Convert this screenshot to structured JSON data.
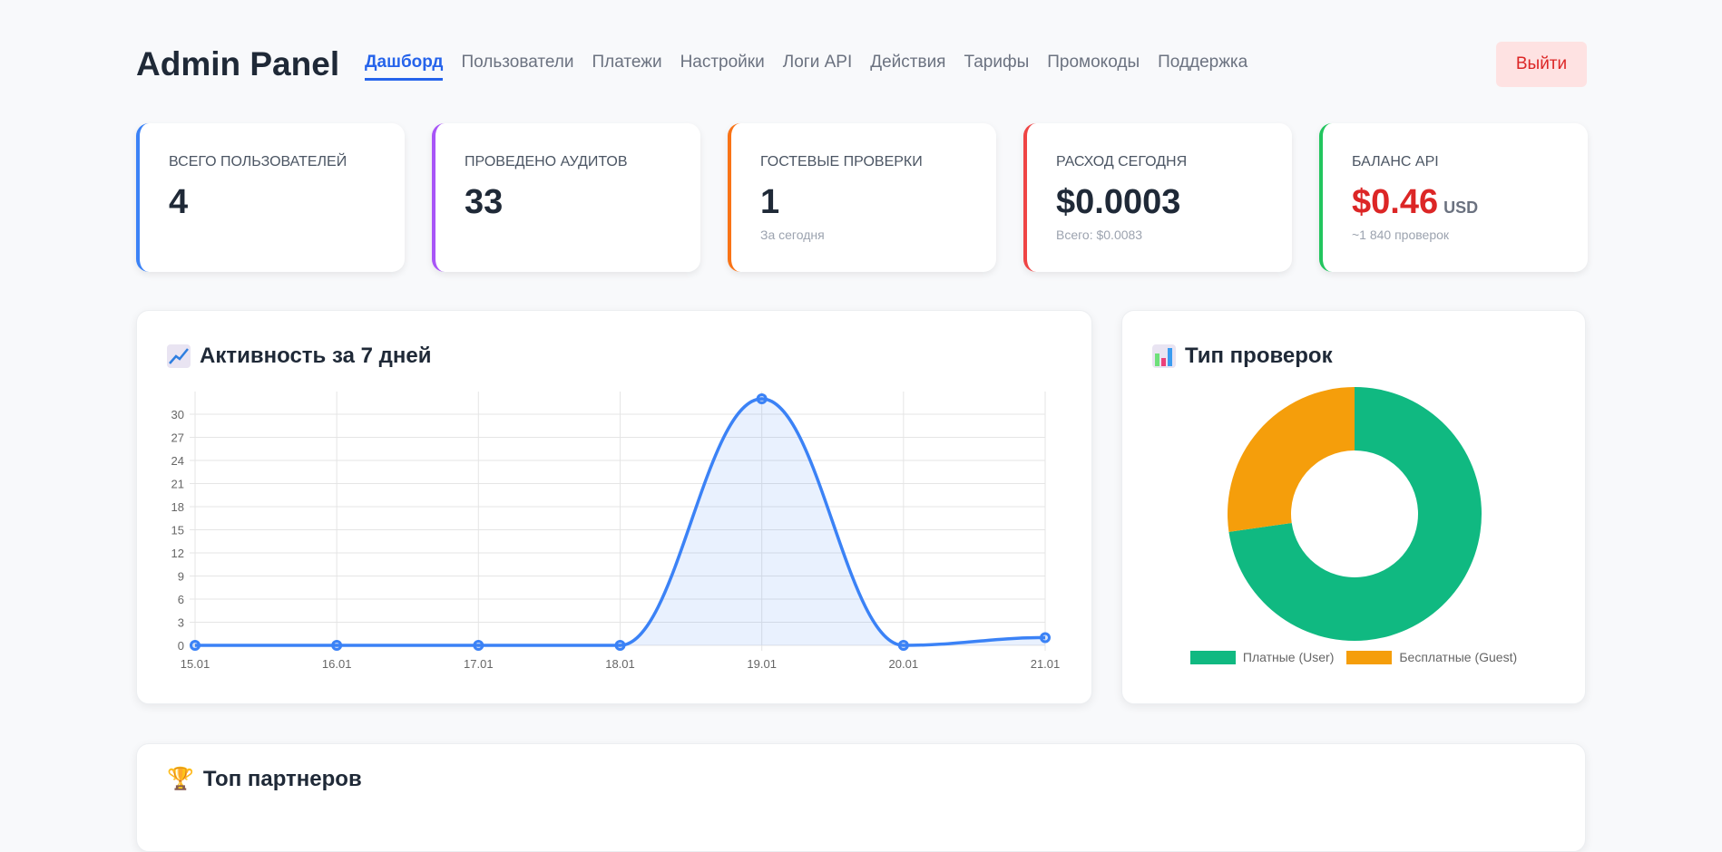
{
  "header": {
    "title": "Admin Panel",
    "logout": "Выйти",
    "nav": [
      "Дашборд",
      "Пользователи",
      "Платежи",
      "Настройки",
      "Логи API",
      "Действия",
      "Тарифы",
      "Промокоды",
      "Поддержка"
    ]
  },
  "stats": [
    {
      "label": "Всего пользователей",
      "value": "4",
      "sub": "",
      "color": "#3b82f6"
    },
    {
      "label": "Проведено аудитов",
      "value": "33",
      "sub": "",
      "color": "#a855f7"
    },
    {
      "label": "Гостевые проверки",
      "value": "1",
      "sub": "За сегодня",
      "color": "#f97316"
    },
    {
      "label": "Расход сегодня",
      "value": "$0.0003",
      "sub": "Всего: $0.0083",
      "color": "#ef4444"
    },
    {
      "label": "Баланс API",
      "value": "$0.46",
      "unit": "USD",
      "sub": "~1 840 проверок",
      "color": "#22c55e"
    }
  ],
  "activity": {
    "title": "Активность за 7 дней",
    "icon": "chart-increasing-icon"
  },
  "types": {
    "title": "Тип проверок",
    "icon": "bar-chart-icon"
  },
  "partners": {
    "title": "Топ партнеров",
    "icon": "trophy-icon"
  },
  "chart_data": [
    {
      "type": "line",
      "title": "Активность за 7 дней",
      "categories": [
        "15.01",
        "16.01",
        "17.01",
        "18.01",
        "19.01",
        "20.01",
        "21.01"
      ],
      "values": [
        0,
        0,
        0,
        0,
        32,
        0,
        1
      ],
      "ylim": [
        0,
        32
      ],
      "yticks": [
        0,
        3,
        6,
        9,
        12,
        15,
        18,
        21,
        24,
        27,
        30
      ],
      "color": "#3b82f6",
      "grid": true
    },
    {
      "type": "pie",
      "title": "Тип проверок",
      "labels": [
        "Платные (User)",
        "Бесплатные (Guest)"
      ],
      "values": [
        24,
        9
      ],
      "colors": [
        "#10b981",
        "#f59e0b"
      ],
      "legend": "bottom"
    }
  ]
}
